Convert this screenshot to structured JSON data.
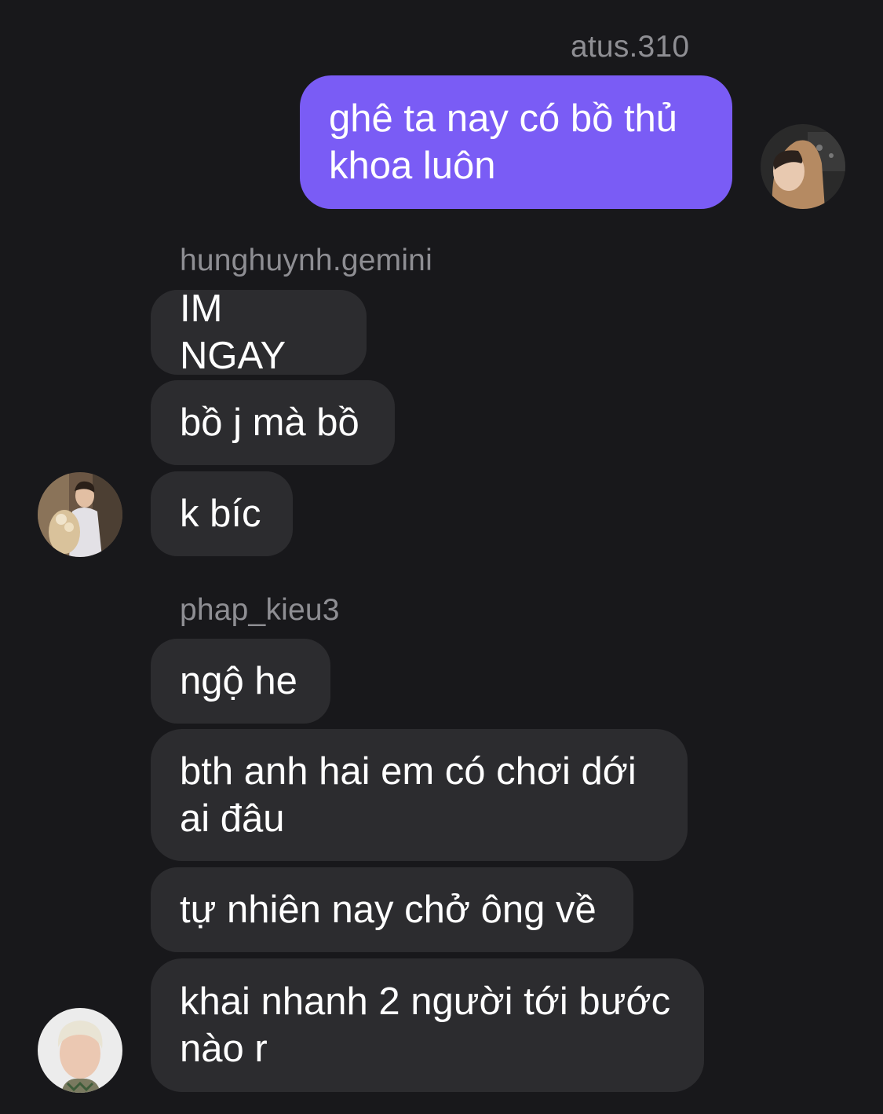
{
  "messages": {
    "outgoing": {
      "sender": "atus.310",
      "text": "ghê ta nay có bồ thủ khoa luôn"
    },
    "group1": {
      "sender": "hunghuynh.gemini",
      "lines": [
        "IM NGAY",
        "bồ j mà bồ",
        "k bíc"
      ]
    },
    "group2": {
      "sender": "phap_kieu3",
      "lines": [
        "ngộ he",
        "bth anh hai em có chơi dới ai đâu",
        "tự nhiên nay chở ông về",
        "khai nhanh 2 người tới bước nào r"
      ]
    }
  },
  "colors": {
    "background": "#18181b",
    "incoming_bubble": "#2c2c2f",
    "outgoing_bubble": "#7a5cf5",
    "sender_name": "#8e8e93",
    "text": "#ffffff"
  },
  "icons": {
    "avatar_outgoing": "user-avatar-hoodie",
    "avatar_group1": "user-avatar-flowers",
    "avatar_group2": "user-avatar-blond"
  }
}
